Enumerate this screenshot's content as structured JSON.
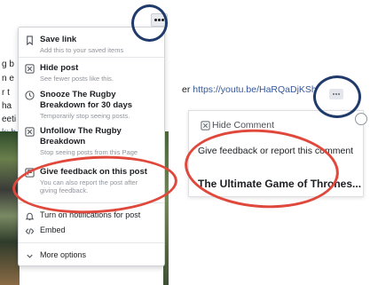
{
  "left_post": {
    "snippets": [
      "g b",
      "n e",
      "r t",
      "ha",
      "eeti",
      "k: h"
    ]
  },
  "post_menu": {
    "items": [
      {
        "title": "Save link",
        "desc": [
          "Add this to your saved items"
        ]
      },
      {
        "title": "Hide post",
        "desc": [
          "See fewer posts like this."
        ]
      },
      {
        "title": "Snooze The Rugby",
        "title2": "Breakdown for 30 days",
        "desc": [
          "Temporarily stop seeing posts."
        ]
      },
      {
        "title": "Unfollow The Rugby",
        "title2": "Breakdown",
        "desc": [
          "Stop seeing posts from this Page"
        ]
      },
      {
        "title": "Give feedback on this post",
        "desc": [
          "You can also report the post after",
          "giving feedback."
        ]
      },
      {
        "title": "Turn on notifications for post"
      },
      {
        "title": "Embed"
      },
      {
        "title": "More options"
      }
    ]
  },
  "comment": {
    "link_prefix": "er",
    "link_text": "https://youtu.be/HaRQaDjKSh",
    "menu_items": [
      "Hide Comment",
      "Give feedback or report this comment"
    ],
    "underlying_text": "The Ultimate Game of Thrones..."
  },
  "colors": {
    "annotation_red": "#e0483c",
    "annotation_blue": "#1f3a6b",
    "link_blue": "#365899"
  },
  "icons": {
    "save": "bookmark-icon",
    "hide": "hide-box-icon",
    "snooze": "clock-icon",
    "unfollow": "unfollow-box-icon",
    "feedback": "flag-box-icon",
    "notifications": "bell-icon",
    "embed": "code-icon",
    "more": "chevron-down-icon"
  }
}
